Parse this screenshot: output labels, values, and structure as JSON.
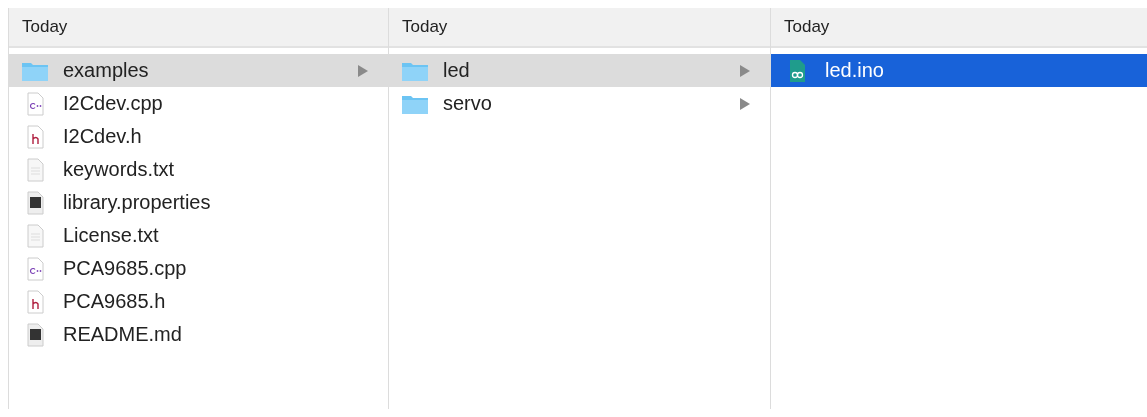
{
  "columns": [
    {
      "header": "Today",
      "active": false,
      "items": [
        {
          "name": "examples",
          "kind": "folder",
          "selected": true
        },
        {
          "name": "I2Cdev.cpp",
          "kind": "cpp",
          "selected": false
        },
        {
          "name": "I2Cdev.h",
          "kind": "header",
          "selected": false
        },
        {
          "name": "keywords.txt",
          "kind": "text",
          "selected": false
        },
        {
          "name": "library.properties",
          "kind": "binary",
          "selected": false
        },
        {
          "name": "License.txt",
          "kind": "text",
          "selected": false
        },
        {
          "name": "PCA9685.cpp",
          "kind": "cpp",
          "selected": false
        },
        {
          "name": "PCA9685.h",
          "kind": "header",
          "selected": false
        },
        {
          "name": "README.md",
          "kind": "binary",
          "selected": false
        }
      ]
    },
    {
      "header": "Today",
      "active": false,
      "items": [
        {
          "name": "led",
          "kind": "folder",
          "selected": true
        },
        {
          "name": "servo",
          "kind": "folder",
          "selected": false
        }
      ]
    },
    {
      "header": "Today",
      "active": true,
      "items": [
        {
          "name": "led.ino",
          "kind": "sketch",
          "selected": true
        }
      ]
    }
  ]
}
